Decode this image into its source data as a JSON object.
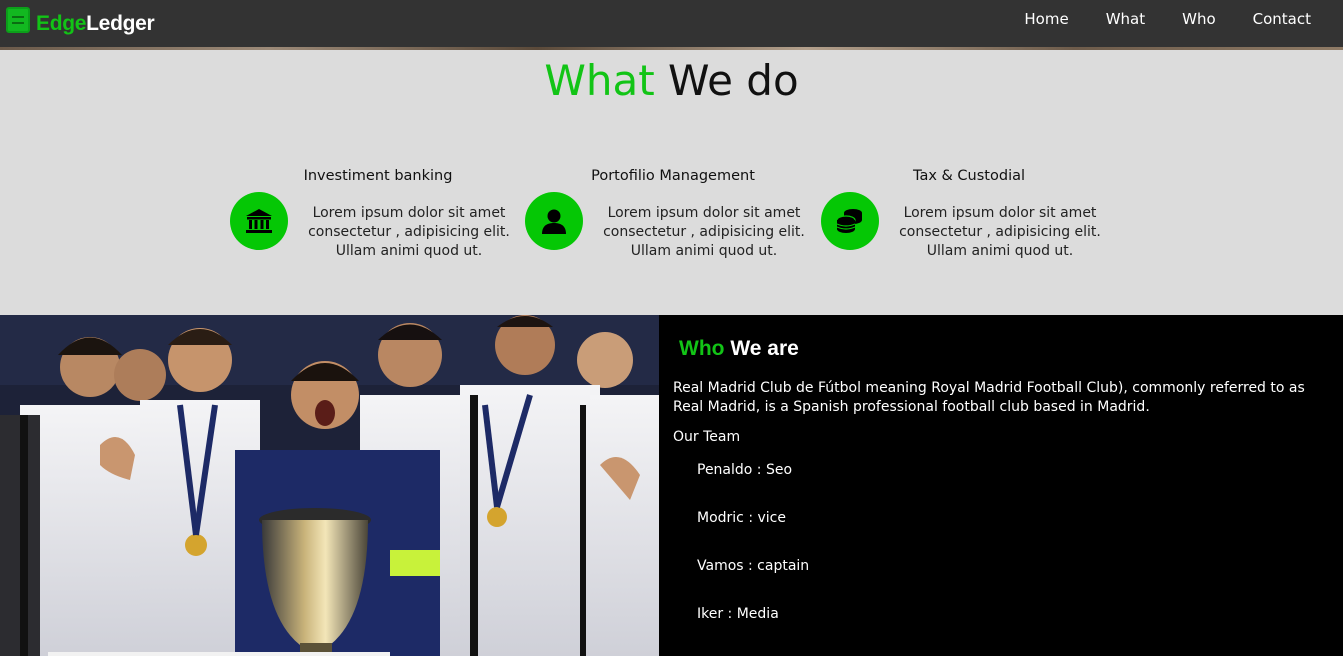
{
  "brand": {
    "part1": "Edge",
    "part2": "Ledger"
  },
  "nav": {
    "items": [
      "Home",
      "What",
      "Who",
      "Contact"
    ]
  },
  "what": {
    "title_accent": "What",
    "title_rest": "We do",
    "services": [
      {
        "heading": "Investiment banking",
        "icon": "bank-icon",
        "desc": "Lorem ipsum dolor sit amet consectetur , adipisicing elit. Ullam animi quod ut."
      },
      {
        "heading": "Portofilio Management",
        "icon": "user-icon",
        "desc": "Lorem ipsum dolor sit amet consectetur , adipisicing elit. Ullam animi quod ut."
      },
      {
        "heading": "Tax & Custodial",
        "icon": "coins-icon",
        "desc": "Lorem ipsum dolor sit amet consectetur , adipisicing elit. Ullam animi quod ut."
      }
    ]
  },
  "who": {
    "title_accent": "Who",
    "title_rest": "We are",
    "description": "Real Madrid Club de Fútbol meaning Royal Madrid Football Club), commonly referred to as Real Madrid, is a Spanish professional football club based in Madrid.",
    "team_heading": "Our Team",
    "team": [
      "Penaldo : Seo",
      "Modric : vice",
      "Vamos : captain",
      "Iker : Media"
    ]
  },
  "colors": {
    "accent": "#12c416",
    "navbar": "#333333",
    "icon_bg": "#05c705"
  }
}
